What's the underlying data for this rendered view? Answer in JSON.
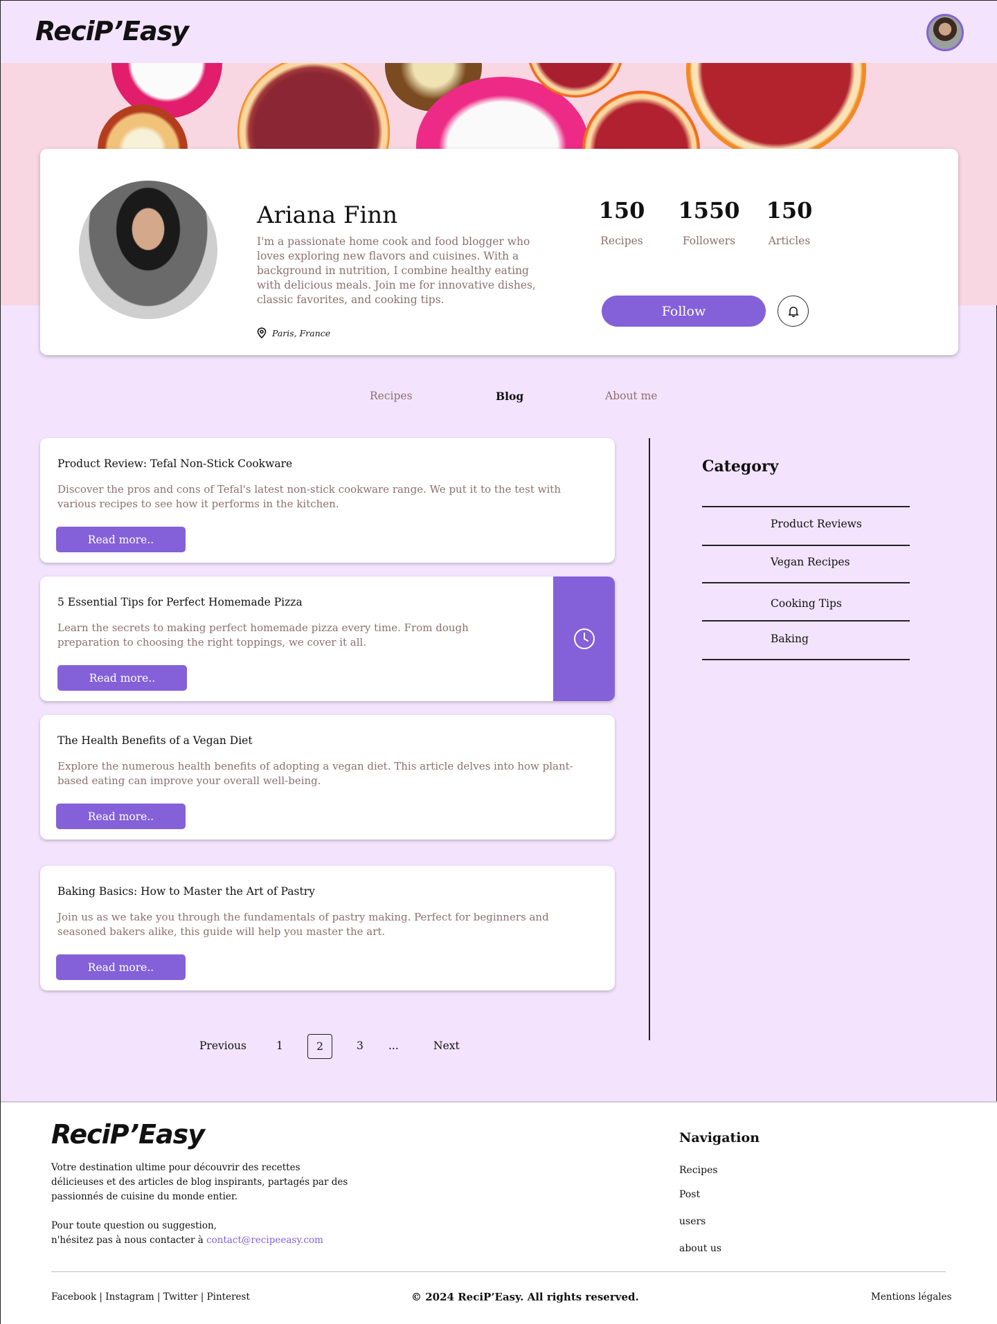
{
  "brand": {
    "name": "ReciP’Easy"
  },
  "profile": {
    "name": "Ariana Finn",
    "bio": "I'm a passionate home cook and food blogger who loves exploring new flavors and cuisines. With a background in nutrition, I combine healthy eating with delicious meals. Join me for innovative dishes, classic favorites, and cooking tips.",
    "location": "Paris, France",
    "stats": [
      {
        "value": "150",
        "label": "Recipes"
      },
      {
        "value": "1550",
        "label": "Followers"
      },
      {
        "value": "150",
        "label": "Articles"
      }
    ],
    "follow_label": "Follow"
  },
  "tabs": [
    {
      "label": "Recipes",
      "active": false
    },
    {
      "label": "Blog",
      "active": true
    },
    {
      "label": "About me",
      "active": false
    }
  ],
  "posts": [
    {
      "title": "Product Review: Tefal Non-Stick Cookware",
      "excerpt": "Discover the pros and cons of Tefal's latest non-stick cookware range. We put it to the test with various recipes to see how it performs in the kitchen.",
      "button": "Read more.."
    },
    {
      "title": "5 Essential Tips for Perfect Homemade Pizza",
      "excerpt": "Learn the secrets to making perfect homemade pizza every time. From dough preparation to choosing the right toppings, we cover it all.",
      "button": "Read more.."
    },
    {
      "title": "The Health Benefits of a Vegan Diet",
      "excerpt": "Explore the numerous health benefits of adopting a vegan diet. This article delves into how plant-based eating can improve your overall well-being.",
      "button": "Read more.."
    },
    {
      "title": "Baking Basics: How to Master the Art of Pastry",
      "excerpt": "Join us as we take you through the fundamentals of pastry making. Perfect for beginners and seasoned bakers alike, this guide will help you master the art.",
      "button": "Read more.."
    }
  ],
  "category": {
    "title": "Category",
    "items": [
      "Product Reviews",
      "Vegan Recipes",
      "Cooking Tips",
      "Baking"
    ]
  },
  "pagination": {
    "previous": "Previous",
    "pages": [
      "1",
      "2",
      "3",
      "..."
    ],
    "current": "2",
    "next": "Next"
  },
  "footer": {
    "logo": "ReciP’Easy",
    "description": "Votre destination ultime pour découvrir des recettes délicieuses et des articles de blog inspirants, partagés par des passionnés de cuisine du monde entier.",
    "contact_line1": "Pour toute question ou suggestion,",
    "contact_line2": "n'hésitez pas à nous contacter à ",
    "contact_email": "contact@recipeeasy.com",
    "nav_title": "Navigation",
    "nav_items": [
      "Recipes",
      "Post",
      "users",
      "about us"
    ],
    "social": "Facebook | Instagram | Twitter | Pinterest",
    "copyright": "© 2024 ReciP’Easy. All rights reserved.",
    "legal": "Mentions légales"
  },
  "colors": {
    "accent": "#8461d8",
    "page_bg": "#f3e3fc",
    "muted_text": "#8c7070",
    "hero_bg": "#f8d6e2"
  },
  "icons": {
    "location": "location-pin-icon",
    "bell": "bell-icon",
    "clock": "clock-icon"
  }
}
